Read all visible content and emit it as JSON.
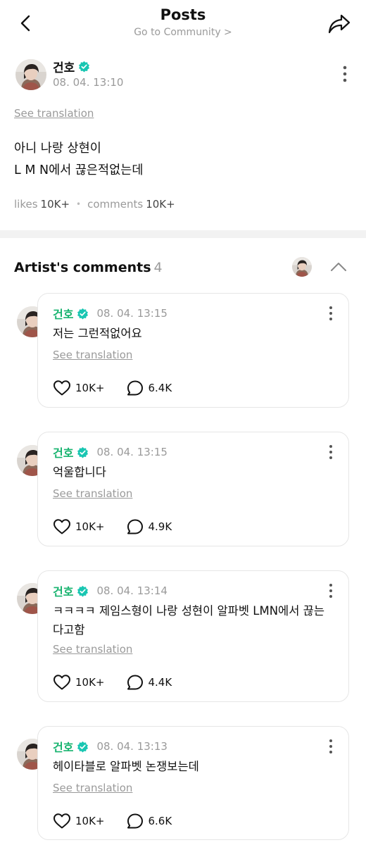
{
  "header": {
    "title": "Posts",
    "subtitle": "Go to Community >"
  },
  "post": {
    "author": "건호",
    "time": "08. 04. 13:10",
    "see_translation": "See translation",
    "body_line1": "아니 나랑 상현이",
    "body_line2": "L M N에서 끊은적없는데",
    "likes_label": "likes",
    "likes_count": "10K+",
    "comments_label": "comments",
    "comments_count": "10K+"
  },
  "artist_comments": {
    "title": "Artist's comments",
    "count": "4",
    "items": [
      {
        "author": "건호",
        "time": "08. 04. 13:15",
        "text": "저는 그런적없어요",
        "see_translation": "See translation",
        "likes": "10K+",
        "replies": "6.4K"
      },
      {
        "author": "건호",
        "time": "08. 04. 13:15",
        "text": "억울합니다",
        "see_translation": "See translation",
        "likes": "10K+",
        "replies": "4.9K"
      },
      {
        "author": "건호",
        "time": "08. 04. 13:14",
        "text": "ㅋㅋㅋㅋ 제임스형이 나랑 성현이 알파벳 LMN에서 끊는다고함",
        "see_translation": "See translation",
        "likes": "10K+",
        "replies": "4.4K"
      },
      {
        "author": "건호",
        "time": "08. 04. 13:13",
        "text": "헤이타블로 알파벳 논쟁보는데",
        "see_translation": "See translation",
        "likes": "10K+",
        "replies": "6.6K"
      }
    ]
  },
  "colors": {
    "accent_green": "#17b36f",
    "verified_teal": "#19c6b2",
    "muted_gray": "#9a9a9a"
  },
  "icons": [
    "back-arrow-icon",
    "share-icon",
    "verified-badge-icon",
    "more-vertical-icon",
    "chevron-up-icon",
    "heart-icon",
    "comment-bubble-icon"
  ]
}
